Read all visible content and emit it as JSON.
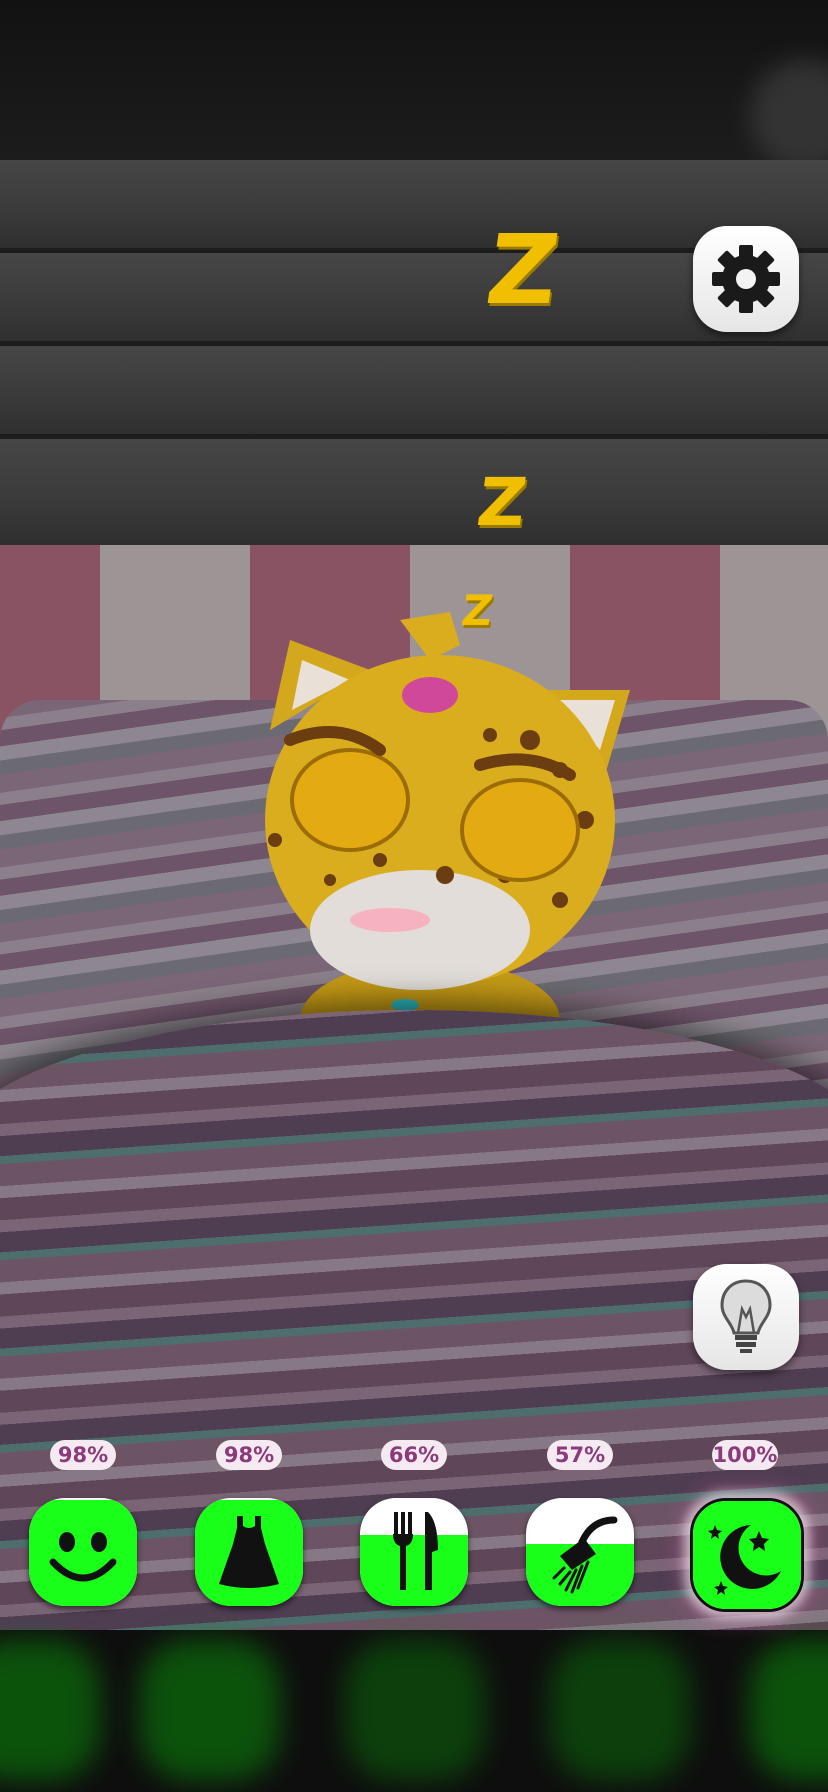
{
  "scene": {
    "state": "sleeping",
    "zzz": [
      "Z",
      "Z",
      "Z"
    ]
  },
  "buttons": {
    "settings_icon": "gear-icon",
    "light_icon": "lightbulb-icon"
  },
  "needs": [
    {
      "key": "happiness",
      "label": "98%",
      "level": 0.98,
      "icon": "smiley-face-icon"
    },
    {
      "key": "clothes",
      "label": "98%",
      "level": 0.98,
      "icon": "dress-icon"
    },
    {
      "key": "food",
      "label": "66%",
      "level": 0.66,
      "icon": "fork-knife-icon"
    },
    {
      "key": "hygiene",
      "label": "57%",
      "level": 0.57,
      "icon": "shower-icon"
    },
    {
      "key": "sleep",
      "label": "100%",
      "level": 1.0,
      "icon": "moon-stars-icon"
    }
  ],
  "colors": {
    "need_fill": "#19ff19",
    "percent_text": "#8b3a7a",
    "percent_bg": "#f5eaf1",
    "zzz": "#f0c000"
  }
}
